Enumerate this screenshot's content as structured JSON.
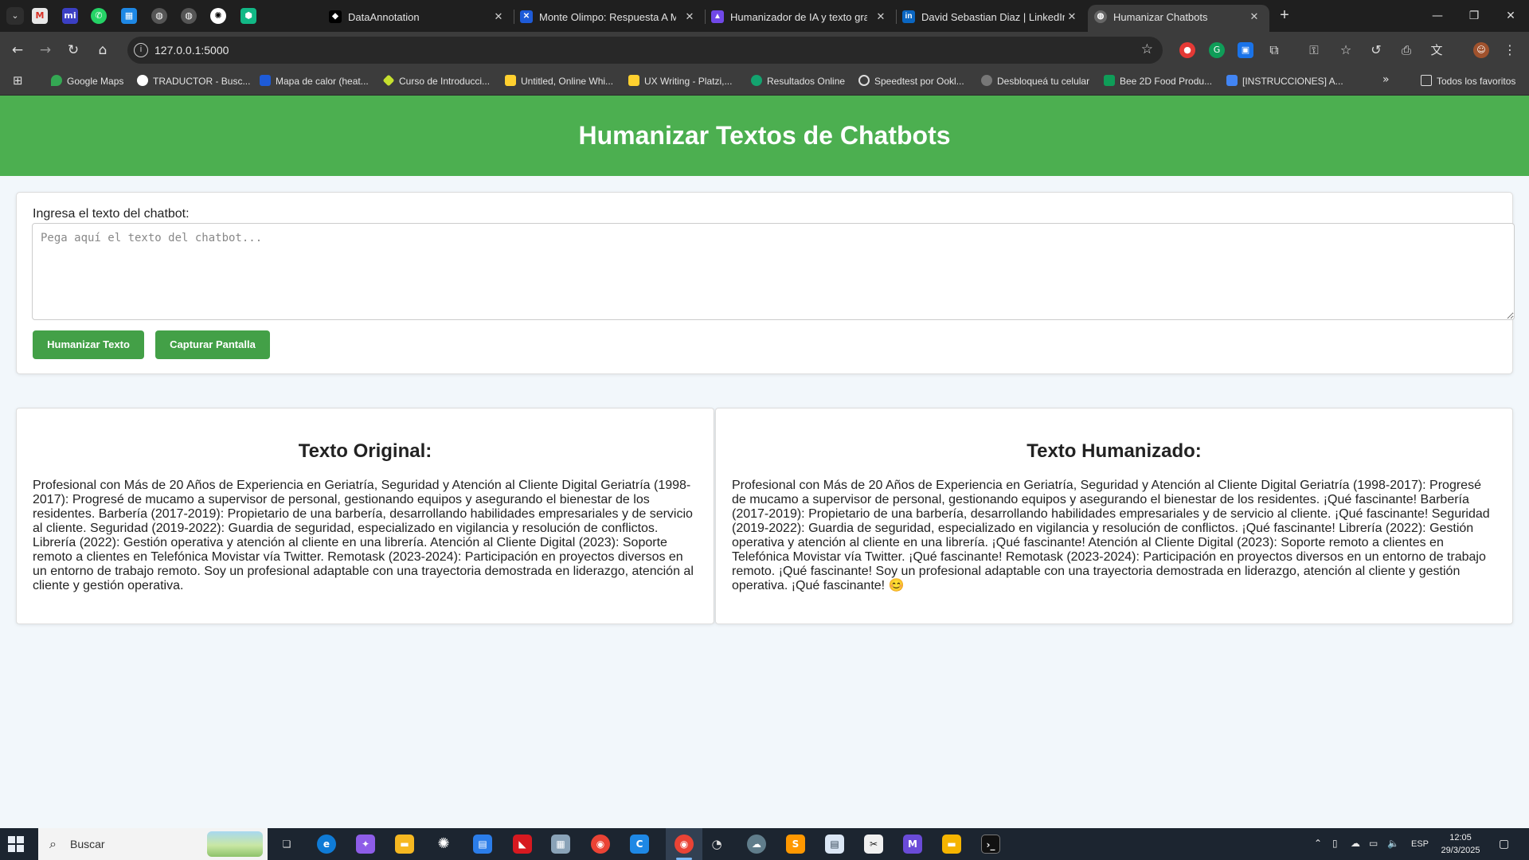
{
  "browser": {
    "tabs": [
      {
        "title": "DataAnnotation",
        "active": false
      },
      {
        "title": "Monte Olimpo: Respuesta A Má",
        "active": false
      },
      {
        "title": "Humanizador de IA y texto grat",
        "active": false
      },
      {
        "title": "David Sebastian Diaz | LinkedIn",
        "active": false
      },
      {
        "title": "Humanizar Chatbots",
        "active": true
      }
    ],
    "address": "127.0.0.1:5000",
    "bookmarks": [
      "Google Maps",
      "TRADUCTOR - Busc...",
      "Mapa de calor (heat...",
      "Curso de Introducci...",
      "Untitled, Online Whi...",
      "UX Writing - Platzi,...",
      "Resultados Online",
      "Speedtest por Ookl...",
      "Desbloqueá tu celular",
      "Bee 2D Food Produ...",
      "[INSTRUCCIONES] A..."
    ],
    "all_bookmarks": "Todos los favoritos",
    "icons": {
      "back": "arrow-left-icon",
      "forward": "arrow-right-icon",
      "reload": "reload-icon",
      "home": "home-icon",
      "bookmark_star": "star-icon"
    }
  },
  "page": {
    "title": "Humanizar Textos de Chatbots",
    "input_label": "Ingresa el texto del chatbot:",
    "textarea_placeholder": "Pega aquí el texto del chatbot...",
    "buttons": {
      "humanize": "Humanizar Texto",
      "capture": "Capturar Pantalla"
    },
    "original": {
      "heading": "Texto Original:",
      "body": "Profesional con Más de 20 Años de Experiencia en Geriatría, Seguridad y Atención al Cliente Digital Geriatría (1998-2017): Progresé de mucamo a supervisor de personal, gestionando equipos y asegurando el bienestar de los residentes. Barbería (2017-2019): Propietario de una barbería, desarrollando habilidades empresariales y de servicio al cliente. Seguridad (2019-2022): Guardia de seguridad, especializado en vigilancia y resolución de conflictos. Librería (2022): Gestión operativa y atención al cliente en una librería. Atención al Cliente Digital (2023): Soporte remoto a clientes en Telefónica Movistar vía Twitter. Remotask (2023-2024): Participación en proyectos diversos en un entorno de trabajo remoto. Soy un profesional adaptable con una trayectoria demostrada en liderazgo, atención al cliente y gestión operativa."
    },
    "humanized": {
      "heading": "Texto Humanizado:",
      "body": "Profesional con Más de 20 Años de Experiencia en Geriatría, Seguridad y Atención al Cliente Digital Geriatría (1998-2017): Progresé de mucamo a supervisor de personal, gestionando equipos y asegurando el bienestar de los residentes. ¡Qué fascinante! Barbería (2017-2019): Propietario de una barbería, desarrollando habilidades empresariales y de servicio al cliente. ¡Qué fascinante! Seguridad (2019-2022): Guardia de seguridad, especializado en vigilancia y resolución de conflictos. ¡Qué fascinante! Librería (2022): Gestión operativa y atención al cliente en una librería. ¡Qué fascinante! Atención al Cliente Digital (2023): Soporte remoto a clientes en Telefónica Movistar vía Twitter. ¡Qué fascinante! Remotask (2023-2024): Participación en proyectos diversos en un entorno de trabajo remoto. ¡Qué fascinante! Soy un profesional adaptable con una trayectoria demostrada en liderazgo, atención al cliente y gestión operativa. ¡Qué fascinante! 😊"
    }
  },
  "taskbar": {
    "search_placeholder": "Buscar",
    "language": "ESP",
    "time": "12:05",
    "date": "29/3/2025"
  },
  "colors": {
    "header_green": "#4caf50",
    "button_green": "#43a047",
    "page_bg": "#f2f7fb",
    "browser_dark": "#1f1f1f",
    "toolbar_gray": "#3c3c3c"
  }
}
